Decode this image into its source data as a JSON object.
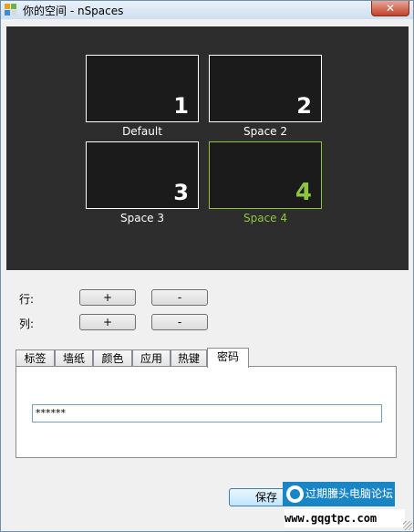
{
  "window": {
    "title": "你的空间 - nSpaces",
    "close_glyph": "✕"
  },
  "spaces": [
    {
      "number": "1",
      "label": "Default",
      "active": false
    },
    {
      "number": "2",
      "label": "Space 2",
      "active": false
    },
    {
      "number": "3",
      "label": "Space 3",
      "active": false
    },
    {
      "number": "4",
      "label": "Space 4",
      "active": true
    }
  ],
  "rows": {
    "label": "行:",
    "add": "+",
    "remove": "-"
  },
  "cols": {
    "label": "列:",
    "add": "+",
    "remove": "-"
  },
  "tabs": [
    "标签",
    "墙纸",
    "颜色",
    "应用",
    "热键",
    "密码"
  ],
  "selected_tab": "密码",
  "password": {
    "value": "******"
  },
  "footer": {
    "save_label": "保存"
  },
  "watermark": {
    "text": "过期黱头电脑论坛",
    "url": "www.gqgtpc.com"
  },
  "colors": {
    "panel_bg": "#2d2d2d",
    "active_accent": "#8cc63f",
    "titlebar": "#dae6f4"
  },
  "icons": {
    "app": "nspaces-app-icon",
    "close": "close-icon",
    "watermark_logo": "site-logo-icon"
  }
}
